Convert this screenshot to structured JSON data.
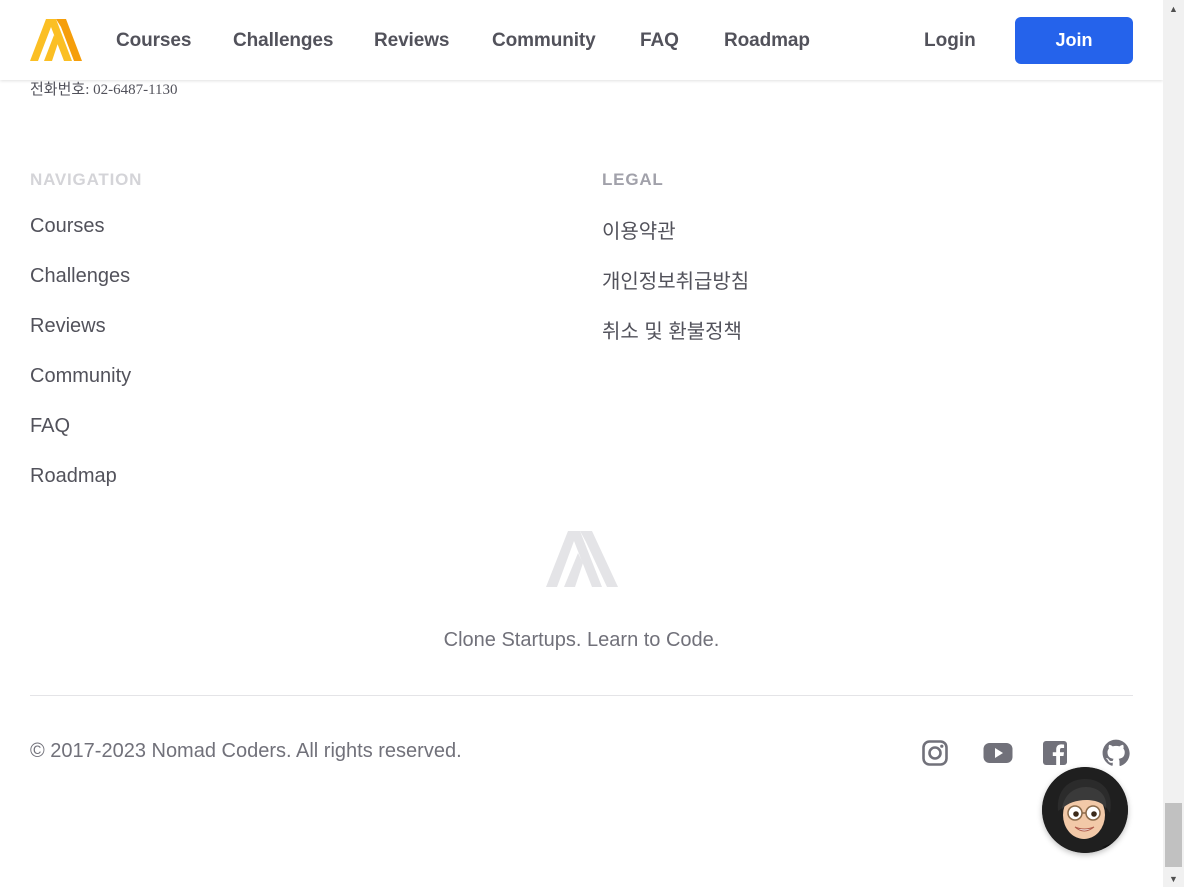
{
  "header": {
    "nav": [
      "Courses",
      "Challenges",
      "Reviews",
      "Community",
      "FAQ",
      "Roadmap"
    ],
    "login_label": "Login",
    "join_label": "Join",
    "logo_icon": "nomad-logo-icon",
    "colors": {
      "logo": "#fbbf24",
      "join_bg": "#2563eb"
    }
  },
  "contact": {
    "phone": "전화번호: 02-6487-1130"
  },
  "footer": {
    "navigation": {
      "title": "NAVIGATION",
      "links": [
        "Courses",
        "Challenges",
        "Reviews",
        "Community",
        "FAQ",
        "Roadmap"
      ]
    },
    "legal": {
      "title": "LEGAL",
      "links": [
        "이용약관",
        "개인정보취급방침",
        "취소 및 환불정책"
      ]
    },
    "tagline": "Clone Startups. Learn to Code.",
    "copyright": "© 2017-2023 Nomad Coders. All rights reserved.",
    "social_icons": [
      "instagram-icon",
      "youtube-icon",
      "facebook-icon",
      "github-icon"
    ],
    "theme_toggle_icon": "moon-icon",
    "chat_icon": "avatar-chat-icon"
  }
}
